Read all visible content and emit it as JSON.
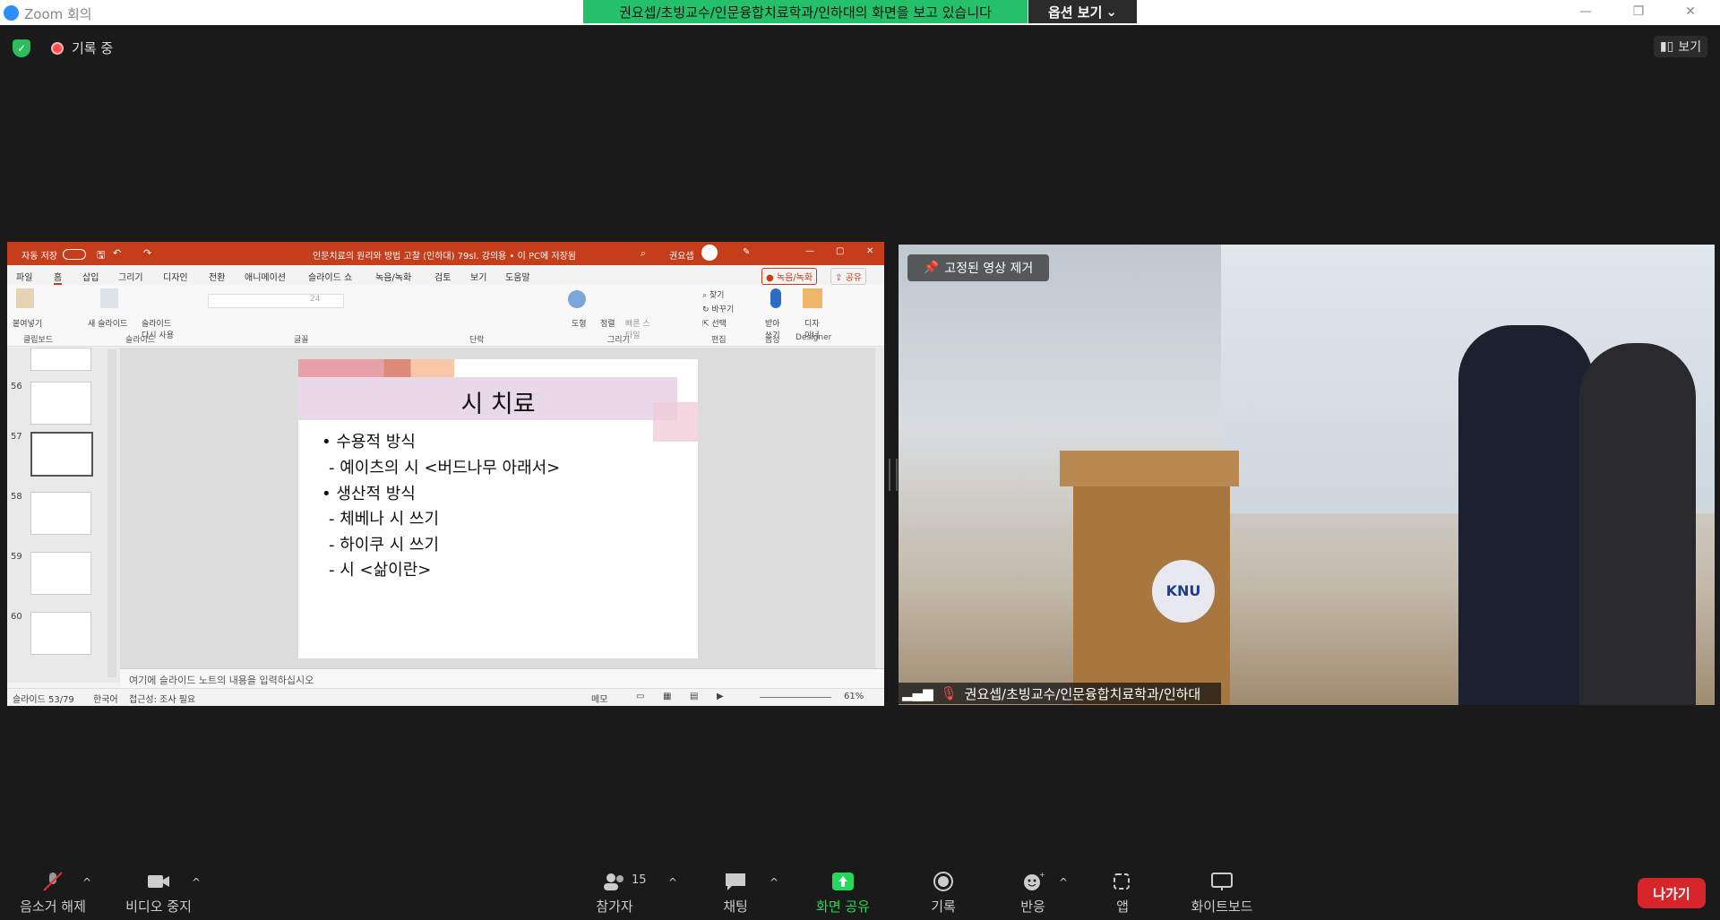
{
  "window": {
    "app_title": "Zoom 회의",
    "logo_text": "zoom"
  },
  "banner": {
    "share_text": "권요셉/초빙교수/인문융합치료학과/인하대의 화면을 보고 있습니다",
    "options_label": "옵션 보기"
  },
  "status": {
    "recording_label": "기록 중",
    "view_label": "보기"
  },
  "ppt": {
    "autosave": "자동 저장",
    "doc_title": "인문치료의 원리와 방법 고찰 (인하대) 79sl. 강의용 • 이 PC에 저장됨",
    "user": "권요셉",
    "menu": [
      "파일",
      "홈",
      "삽입",
      "그리기",
      "디자인",
      "전환",
      "애니메이션",
      "슬라이드 쇼",
      "녹음/녹화",
      "검토",
      "보기",
      "도움말"
    ],
    "record_btn": "녹음/녹화",
    "share_btn": "공유",
    "ribbon_groups": [
      "클립보드",
      "슬라이드",
      "글꼴",
      "단락",
      "그리기",
      "편집",
      "음성",
      "Designer"
    ],
    "ribbon_labels": {
      "paste": "붙여넣기",
      "new_slide": "새 슬라이드",
      "reuse_slide": "슬라이드 다시 사용",
      "shape": "도형",
      "arrange": "정렬",
      "quick_style": "빠른 스타일",
      "find": "찾기",
      "replace": "바꾸기",
      "select": "선택",
      "dictate": "받아 쓰기",
      "designer": "디자 이너",
      "font_size": "24"
    },
    "thumb_numbers": [
      "56",
      "57",
      "58",
      "59",
      "60"
    ],
    "slide": {
      "title": "시 치료",
      "lines": [
        "• 수용적 방식",
        "- 예이츠의 시 <버드나무 아래서>",
        "• 생산적 방식",
        "- 체베나 시 쓰기",
        "- 하이쿠 시 쓰기",
        "- 시 <삶이란>"
      ]
    },
    "notes_placeholder": "여기에 슬라이드 노트의 내용을 입력하십시오",
    "status": {
      "slide_counter": "슬라이드 53/79",
      "language": "한국어",
      "accessibility": "접근성: 조사 필요",
      "notes_btn": "메모",
      "zoom": "61%"
    }
  },
  "video": {
    "pin_label": "고정된 영상 제거",
    "participant_name": "권요셉/초빙교수/인문융합치료학과/인하대",
    "podium_logo": "KNU"
  },
  "toolbar": {
    "mute": "음소거 해제",
    "video": "비디오 중지",
    "participants": "참가자",
    "participant_count": "15",
    "chat": "채팅",
    "share": "화면 공유",
    "record": "기록",
    "reactions": "반응",
    "apps": "앱",
    "whiteboard": "화이트보드",
    "leave": "나가기"
  },
  "colors": {
    "accent_green": "#24c16a",
    "ppt_red": "#c43e1c",
    "leave_red": "#d6262b",
    "share_green": "#23d959"
  }
}
